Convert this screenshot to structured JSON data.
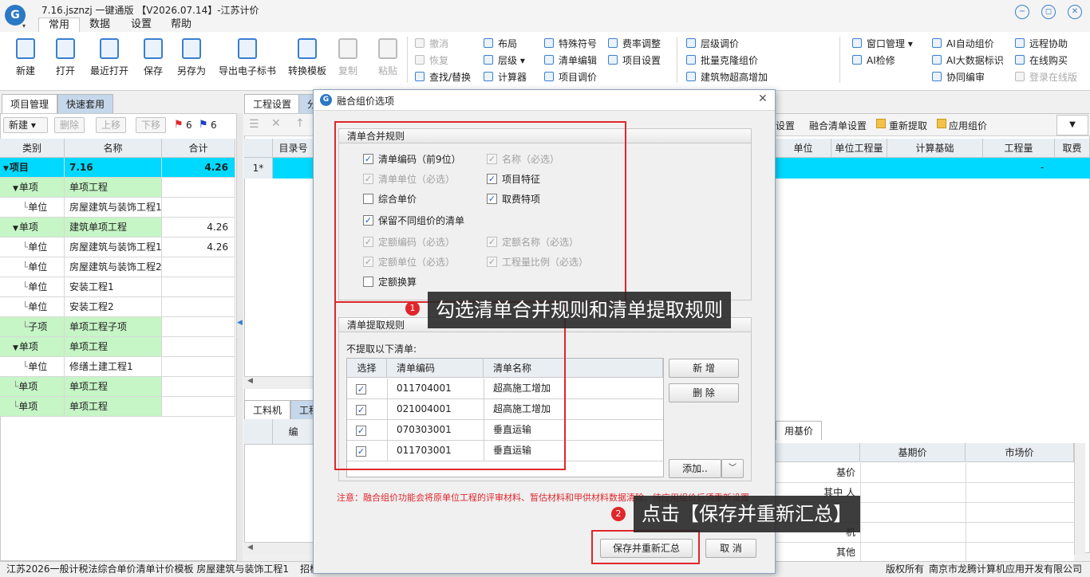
{
  "app": {
    "title": "7.16.jsznzj 一键通版 【V2026.07.14】-江苏计价",
    "menu_tabs": [
      "常用",
      "数据",
      "设置",
      "帮助"
    ]
  },
  "ribbon": {
    "big_buttons": [
      {
        "label": "新建",
        "disabled": false
      },
      {
        "label": "打开",
        "disabled": false
      },
      {
        "label": "最近打开",
        "disabled": false
      },
      {
        "label": "保存",
        "disabled": false
      },
      {
        "label": "另存为",
        "disabled": false
      },
      {
        "label": "导出电子标书",
        "disabled": false
      },
      {
        "label": "转换模板",
        "disabled": false
      },
      {
        "label": "复制",
        "disabled": true
      },
      {
        "label": "粘贴",
        "disabled": true
      }
    ],
    "col1": [
      {
        "label": "撤消",
        "disabled": true
      },
      {
        "label": "恢复",
        "disabled": true
      },
      {
        "label": "查找/替换",
        "disabled": false
      }
    ],
    "col2": [
      {
        "label": "布局",
        "disabled": false
      },
      {
        "label": "层级 ▾",
        "disabled": false
      },
      {
        "label": "计算器",
        "disabled": false
      }
    ],
    "col3": [
      {
        "label": "特殊符号",
        "disabled": false
      },
      {
        "label": "清单编辑",
        "disabled": false
      },
      {
        "label": "项目调价",
        "disabled": false
      }
    ],
    "col4": [
      {
        "label": "费率调整",
        "disabled": false
      },
      {
        "label": "项目设置",
        "disabled": false
      }
    ],
    "col5": [
      {
        "label": "层级调价",
        "disabled": false
      },
      {
        "label": "批量克隆组价",
        "disabled": false
      },
      {
        "label": "建筑物超高增加",
        "disabled": false
      }
    ],
    "col6": [
      {
        "label": "窗口管理 ▾",
        "disabled": false
      },
      {
        "label": "AI检修",
        "disabled": false
      }
    ],
    "col7": [
      {
        "label": "AI自动组价",
        "disabled": false
      },
      {
        "label": "AI大数据标识",
        "disabled": false
      },
      {
        "label": "协同编审",
        "disabled": false
      }
    ],
    "col8": [
      {
        "label": "远程协助",
        "disabled": false
      },
      {
        "label": "在线购买",
        "disabled": false
      },
      {
        "label": "登录在线版",
        "disabled": true
      }
    ]
  },
  "left_panel": {
    "tabs": [
      "项目管理",
      "快速套用"
    ],
    "toolbar": {
      "new": "新建",
      "delete": "删除",
      "up": "上移",
      "down": "下移",
      "red_flag_count": "6",
      "blue_flag_count": "6"
    },
    "headers": [
      "类别",
      "名称",
      "合计"
    ],
    "rows": [
      {
        "type": "项目",
        "name": "7.16",
        "total": "4.26",
        "style": "cyan",
        "indent": 0,
        "expand": "▼"
      },
      {
        "type": "单项",
        "name": "单项工程",
        "total": "",
        "style": "green",
        "indent": 1,
        "expand": "▼"
      },
      {
        "type": "单位",
        "name": "房屋建筑与装饰工程1",
        "total": "",
        "style": "white",
        "indent": 2,
        "expand": ""
      },
      {
        "type": "单项",
        "name": "建筑单项工程",
        "total": "4.26",
        "style": "green",
        "indent": 1,
        "expand": "▼"
      },
      {
        "type": "单位",
        "name": "房屋建筑与装饰工程1",
        "total": "4.26",
        "style": "white",
        "indent": 2,
        "expand": ""
      },
      {
        "type": "单位",
        "name": "房屋建筑与装饰工程2",
        "total": "",
        "style": "white",
        "indent": 2,
        "expand": ""
      },
      {
        "type": "单位",
        "name": "安装工程1",
        "total": "",
        "style": "white",
        "indent": 2,
        "expand": ""
      },
      {
        "type": "单位",
        "name": "安装工程2",
        "total": "",
        "style": "white",
        "indent": 2,
        "expand": ""
      },
      {
        "type": "子项",
        "name": "单项工程子项",
        "total": "",
        "style": "green",
        "indent": 2,
        "expand": ""
      },
      {
        "type": "单项",
        "name": "单项工程",
        "total": "",
        "style": "green",
        "indent": 1,
        "expand": "▼"
      },
      {
        "type": "单位",
        "name": "修缮土建工程1",
        "total": "",
        "style": "white",
        "indent": 2,
        "expand": ""
      },
      {
        "type": "单项",
        "name": "单项工程",
        "total": "",
        "style": "green",
        "indent": 1,
        "expand": ""
      },
      {
        "type": "单项",
        "name": "单项工程",
        "total": "",
        "style": "green",
        "indent": 1,
        "expand": ""
      }
    ]
  },
  "right_panel": {
    "tabs": [
      "工程设置",
      "分"
    ],
    "toolbar_right": [
      "设置",
      "融合清单设置",
      "重新提取",
      "应用组价"
    ],
    "header_left": "目录号",
    "row_marker": "1*",
    "headers_right": [
      "单位",
      "单位工程量",
      "计算基础",
      "工程量",
      "取费"
    ],
    "cyan_dash": "-",
    "bottom_tabs": [
      "工料机",
      "工程"
    ],
    "bottom_header": "编",
    "lower_right": {
      "tab": "用基价",
      "headers": [
        "基期价",
        "市场价"
      ],
      "rows": [
        "基价",
        "其中 人",
        "",
        "机",
        "其他"
      ]
    }
  },
  "dialog": {
    "title": "融合组价选项",
    "merge_rules_title": "清单合并规则",
    "merge_rules": [
      {
        "label": "清单编码（前9位）",
        "checked": true,
        "disabled": false
      },
      {
        "label": "名称（必选）",
        "checked": true,
        "disabled": true
      },
      {
        "label": "清单单位（必选）",
        "checked": true,
        "disabled": true
      },
      {
        "label": "项目特征",
        "checked": true,
        "disabled": false
      },
      {
        "label": "综合单价",
        "checked": false,
        "disabled": false
      },
      {
        "label": "取费特项",
        "checked": true,
        "disabled": false
      },
      {
        "label": "保留不同组价的清单",
        "checked": true,
        "disabled": false
      },
      {
        "label": "定额编码（必选）",
        "checked": true,
        "disabled": true
      },
      {
        "label": "定额名称（必选）",
        "checked": true,
        "disabled": true
      },
      {
        "label": "定额单位（必选）",
        "checked": true,
        "disabled": true
      },
      {
        "label": "工程量比例（必选）",
        "checked": true,
        "disabled": true
      },
      {
        "label": "定额换算",
        "checked": false,
        "disabled": false
      }
    ],
    "extract_rules_title": "清单提取规则",
    "extract_subtitle": "不提取以下清单:",
    "table_headers": [
      "选择",
      "清单编码",
      "清单名称"
    ],
    "table_rows": [
      {
        "code": "011704001",
        "name": "超高施工增加",
        "checked": true
      },
      {
        "code": "021004001",
        "name": "超高施工增加",
        "checked": true
      },
      {
        "code": "070303001",
        "name": "垂直运输",
        "checked": true
      },
      {
        "code": "011703001",
        "name": "垂直运输",
        "checked": true
      }
    ],
    "side_buttons": {
      "add": "新 增",
      "delete": "删 除",
      "append": "添加.."
    },
    "note": "注意：融合组价功能会将原单位工程的评审材料、暂估材料和甲供材料数据清除，待应用组价后须重新设置",
    "save_button": "保存并重新汇总",
    "cancel_button": "取 消"
  },
  "callouts": [
    {
      "num": "1",
      "text": "勾选清单合并规则和清单提取规则"
    },
    {
      "num": "2",
      "text": "点击【保存并重新汇总】"
    }
  ],
  "statusbar": {
    "left": "江苏2026一般计税法综合单价清单计价模板 房屋建筑与装饰工程1",
    "left2": "招标",
    "right1": "版权所有",
    "right2": "南京市龙腾计算机应用开发有限公司"
  },
  "colors": {
    "accent": "#3a7fd0",
    "highlight_cyan": "#00d9ff",
    "row_green": "#c6f5c6",
    "red": "#e0262b"
  }
}
